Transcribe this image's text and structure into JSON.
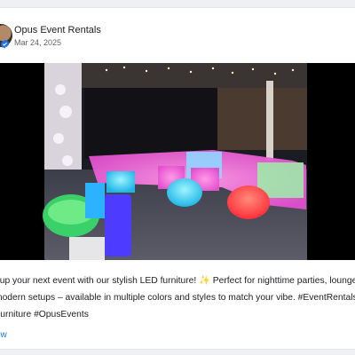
{
  "post": {
    "business_name": "Opus Event Rentals",
    "date": "Mar 24, 2025",
    "avatar_icon": "profile-photo-icon",
    "verified_icon": "verified-badge-icon",
    "text_lines": [
      "t up your next event with our stylish LED furniture! ✨ Perfect for nighttime parties, lounge",
      "modern setups – available in multiple colors and styles to match your vibe. #EventRentals",
      "Furniture #OpusEvents"
    ],
    "link_label": "ow"
  },
  "colors": {
    "link": "#1a73e8",
    "verified": "#1a73e8",
    "card_bg": "#ffffff",
    "page_bg": "#eef0f3"
  }
}
